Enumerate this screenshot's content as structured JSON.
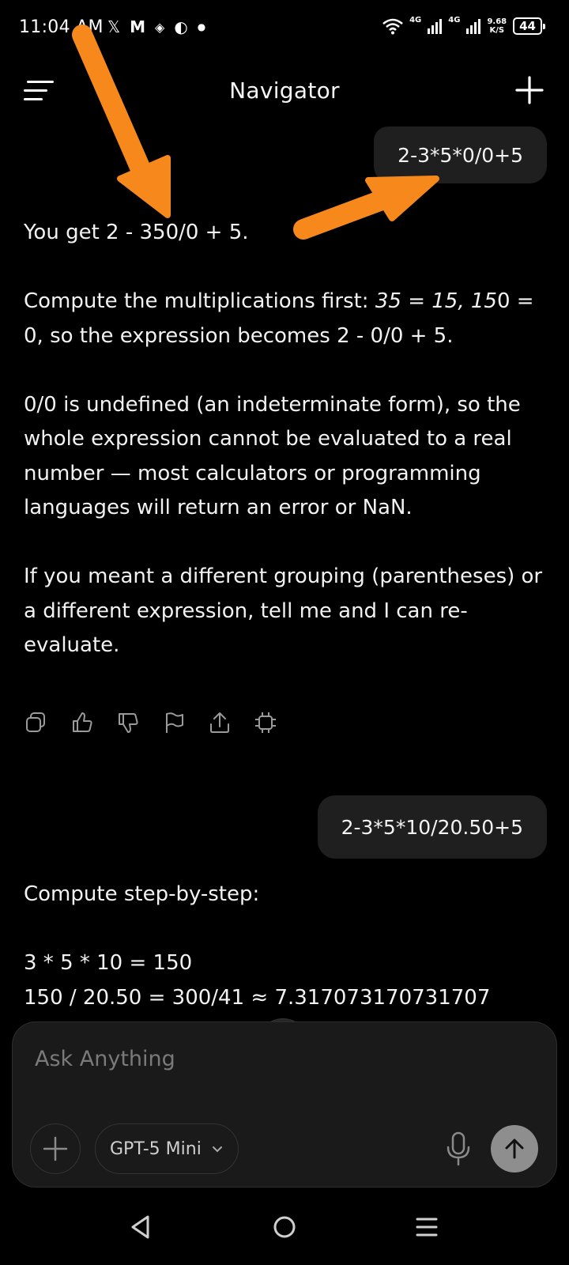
{
  "status_bar": {
    "time": "11:04 AM",
    "network_1": "4G",
    "network_2": "4G",
    "speed_value": "9.68",
    "speed_unit": "K/S",
    "battery": "44"
  },
  "header": {
    "title": "Navigator"
  },
  "chat": {
    "messages": [
      {
        "role": "user",
        "text": "2-3*5*0/0+5"
      },
      {
        "role": "assistant",
        "p1": "You get 2 - 350/0 + 5.",
        "p2a": "Compute the multiplications first: ",
        "p2b": "35 = 15, 15",
        "p2c": "0 = 0, so the expression becomes 2 - 0/0 + 5.",
        "p3": "0/0 is undefined (an indeterminate form), so the whole expression cannot be evaluated to a real number — most calculators or programming languages will return an error or NaN.",
        "p4": "If you meant a different grouping (parentheses) or a different expression, tell me and I can re-evaluate."
      },
      {
        "role": "user",
        "text": "2-3*5*10/20.50+5"
      },
      {
        "role": "assistant",
        "p1": "Compute step-by-step:",
        "p2": "3 * 5 * 10 = 150",
        "p3": "150 / 20.50 = 300/41 ≈ 7.317073170731707"
      }
    ],
    "actions": [
      "copy-icon",
      "thumbs-up-icon",
      "thumbs-down-icon",
      "flag-icon",
      "share-icon",
      "chip-icon"
    ]
  },
  "composer": {
    "placeholder": "Ask Anything",
    "model": "GPT-5 Mini"
  },
  "colors": {
    "background": "#000000",
    "bubble": "#1f1f1f",
    "annotation_arrow": "#f7891c",
    "send_button": "#8e8e8e"
  }
}
